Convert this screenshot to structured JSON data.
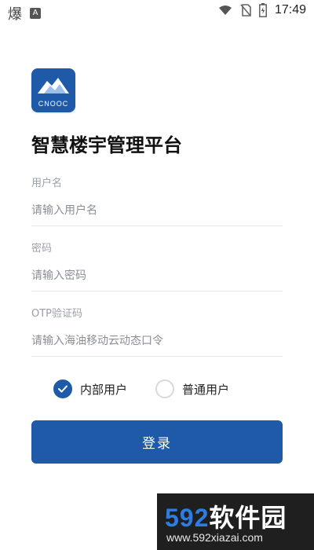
{
  "status_bar": {
    "left_icons": [
      "app-glyph-icon",
      "a-badge-icon"
    ],
    "left_glyph": "爆",
    "left_badge": "A",
    "right_icons": [
      "wifi-icon",
      "no-sim-icon",
      "battery-icon"
    ],
    "time": "17:49"
  },
  "app": {
    "logo_text": "CNOOC",
    "title": "智慧楼宇管理平台"
  },
  "form": {
    "username": {
      "label": "用户名",
      "placeholder": "请输入用户名",
      "value": ""
    },
    "password": {
      "label": "密码",
      "placeholder": "请输入密码",
      "value": ""
    },
    "otp": {
      "label": "OTP验证码",
      "placeholder": "请输入海油移动云动态口令",
      "value": ""
    }
  },
  "user_type": {
    "options": [
      {
        "label": "内部用户",
        "checked": true
      },
      {
        "label": "普通用户",
        "checked": false
      }
    ]
  },
  "login_button": {
    "label": "登录"
  },
  "watermark": {
    "num": "592",
    "text": "软件园",
    "url": "www.592xiazai.com"
  },
  "colors": {
    "accent": "#1e5aa8",
    "divider": "#e5e7ea",
    "label": "#9aa0a6"
  }
}
